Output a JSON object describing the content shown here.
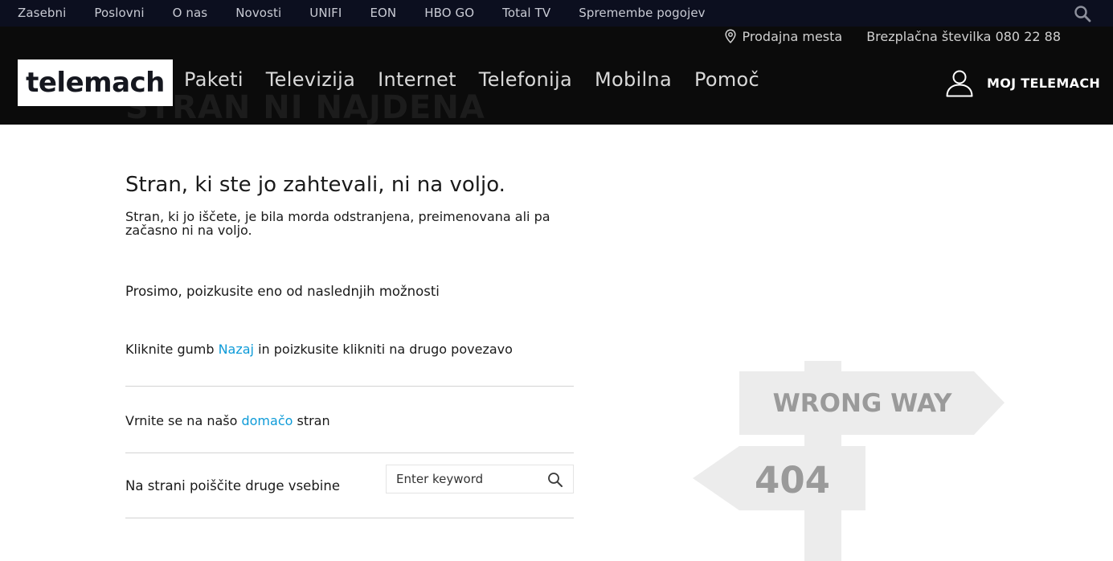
{
  "topbar": {
    "links": [
      "Zasebni",
      "Poslovni",
      "O nas",
      "Novosti",
      "UNIFI",
      "EON",
      "HBO GO",
      "Total TV",
      "Spremembe pogojev"
    ],
    "search_icon": "search-icon"
  },
  "header": {
    "ghost_title": "STRAN NI NAJDENA",
    "store_label": "Prodajna mesta",
    "phone_label": "Brezplačna številka 080 22 88",
    "logo_text": "telemach",
    "nav": [
      "Paketi",
      "Televizija",
      "Internet",
      "Telefonija",
      "Mobilna",
      "Pomoč"
    ],
    "account_label": "MOJ TELEMACH",
    "account_icon": "user-icon"
  },
  "content": {
    "headline": "Stran, ki ste jo zahtevali, ni na voljo.",
    "description": "Stran, ki jo iščete, je bila morda odstranjena, preimenovana ali pa začasno ni na voljo.",
    "prompt": "Prosimo, poizkusite eno od naslednjih možnosti",
    "option_back": {
      "before": "Kliknite gumb ",
      "link": "Nazaj",
      "after": " in poizkusite klikniti na drugo povezavo"
    },
    "option_home": {
      "before": "Vrnite se na našo ",
      "link": "domačo",
      "after": " stran"
    },
    "search_label": "Na strani poiščite druge vsebine",
    "search_placeholder": "Enter keyword"
  },
  "illustration": {
    "sign_top": "WRONG WAY",
    "sign_bottom": "404"
  },
  "colors": {
    "topbar_bg": "#0c0f1f",
    "header_bg": "#0b0b0b",
    "link": "#0e9bd8",
    "sign_fill": "#ececec",
    "sign_text": "#9a9a9a"
  }
}
